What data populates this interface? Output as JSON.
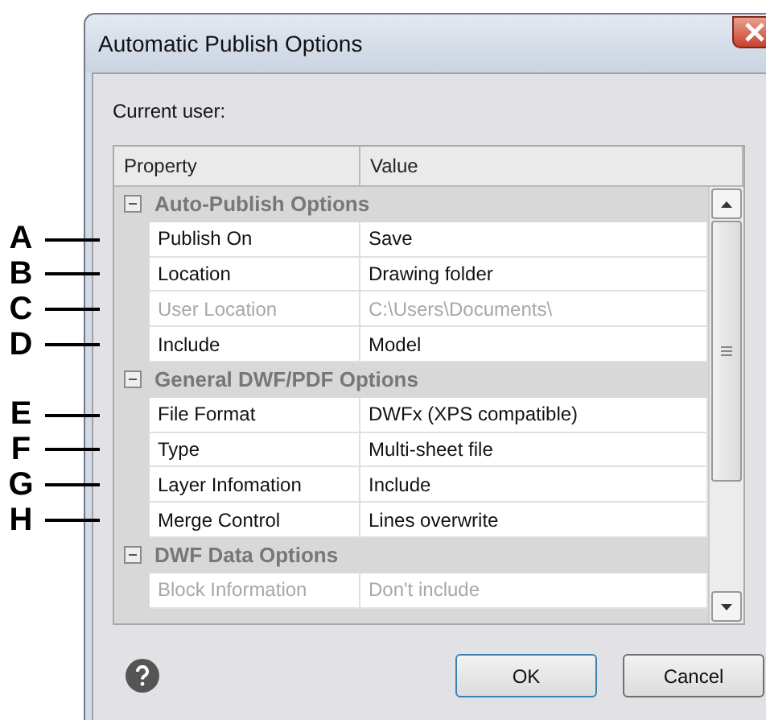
{
  "window": {
    "title": "Automatic Publish Options"
  },
  "current_user_label": "Current user:",
  "grid": {
    "columns": [
      "Property",
      "Value"
    ],
    "groups": [
      {
        "label": "Auto-Publish Options",
        "expanded": true,
        "children": [
          {
            "callout": "A",
            "property": "Publish On",
            "value": "Save",
            "disabled": false
          },
          {
            "callout": "B",
            "property": "Location",
            "value": "Drawing folder",
            "disabled": false
          },
          {
            "callout": "C",
            "property": "User Location",
            "value": "C:\\Users\\Documents\\",
            "disabled": true
          },
          {
            "callout": "D",
            "property": "Include",
            "value": "Model",
            "disabled": false
          }
        ]
      },
      {
        "label": "General DWF/PDF Options",
        "expanded": true,
        "children": [
          {
            "callout": "E",
            "property": "File Format",
            "value": "DWFx (XPS compatible)",
            "disabled": false
          },
          {
            "callout": "F",
            "property": "Type",
            "value": "Multi-sheet file",
            "disabled": false
          },
          {
            "callout": "G",
            "property": "Layer Infomation",
            "value": "Include",
            "disabled": false
          },
          {
            "callout": "H",
            "property": "Merge Control",
            "value": "Lines overwrite",
            "disabled": false
          }
        ]
      },
      {
        "label": "DWF Data Options",
        "expanded": true,
        "children": [
          {
            "property": "Block Information",
            "value": "Don't include",
            "disabled": true
          }
        ]
      }
    ]
  },
  "buttons": [
    "OK",
    "Cancel"
  ]
}
